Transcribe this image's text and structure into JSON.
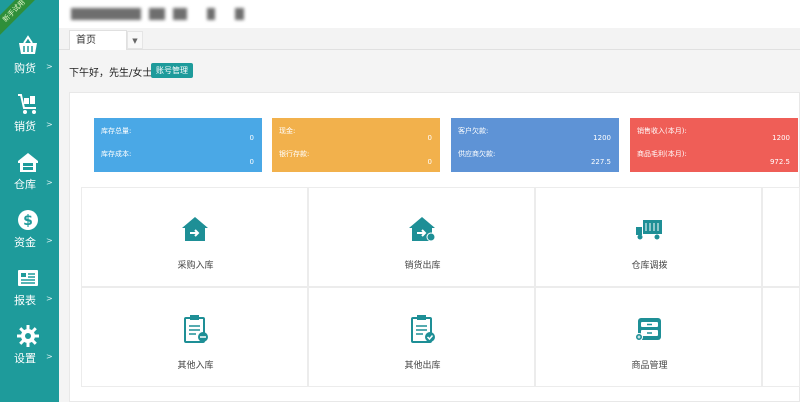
{
  "ribbon": "新手试用",
  "sidebar": {
    "items": [
      {
        "label": "购货",
        "icon": "basket-icon"
      },
      {
        "label": "销货",
        "icon": "cart-icon"
      },
      {
        "label": "仓库",
        "icon": "warehouse-icon"
      },
      {
        "label": "资金",
        "icon": "dollar-icon"
      },
      {
        "label": "报表",
        "icon": "report-icon"
      },
      {
        "label": "设置",
        "icon": "gear-icon"
      }
    ],
    "arrow": ">"
  },
  "tabs": [
    {
      "label": "首页"
    }
  ],
  "tab_dropdown": "▼",
  "greeting": "下午好，先生/女士",
  "account_button": "账号管理",
  "cards": [
    {
      "color": "#4aa8e6",
      "rows": [
        {
          "label": "库存总量:",
          "value": "0"
        },
        {
          "label": "库存成本:",
          "value": "0"
        }
      ]
    },
    {
      "color": "#f2b14c",
      "rows": [
        {
          "label": "现金:",
          "value": "0"
        },
        {
          "label": "银行存款:",
          "value": "0"
        }
      ]
    },
    {
      "color": "#5e93d6",
      "rows": [
        {
          "label": "客户欠款:",
          "value": "1200"
        },
        {
          "label": "供应商欠款:",
          "value": "227.5"
        }
      ]
    },
    {
      "color": "#ef5e57",
      "rows": [
        {
          "label": "销售收入(本月):",
          "value": "1200"
        },
        {
          "label": "商品毛利(本月):",
          "value": "972.5"
        }
      ]
    }
  ],
  "tiles": [
    {
      "label": "采购入库",
      "icon": "house-in-icon"
    },
    {
      "label": "销货出库",
      "icon": "house-out-icon"
    },
    {
      "label": "仓库调拨",
      "icon": "truck-icon"
    },
    {
      "label": "其他入库",
      "icon": "clipboard-in-icon"
    },
    {
      "label": "其他出库",
      "icon": "clipboard-out-icon"
    },
    {
      "label": "商品管理",
      "icon": "cabinet-icon"
    }
  ],
  "accent_color": "#1e9b9b",
  "icon_color": "#1e8f96"
}
